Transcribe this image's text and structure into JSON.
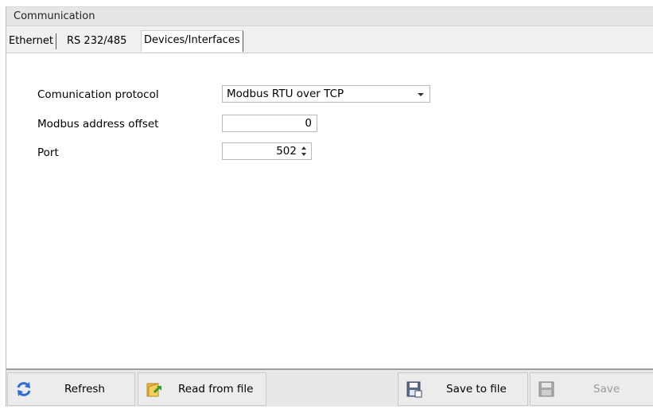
{
  "group": {
    "title": "Communication"
  },
  "tabs": [
    {
      "label": "Ethernet",
      "active": false
    },
    {
      "label": "RS 232/485",
      "active": false
    },
    {
      "label": "Devices/Interfaces",
      "active": true
    }
  ],
  "form": {
    "protocol_label": "Comunication protocol",
    "protocol_value": "Modbus RTU over TCP",
    "offset_label": "Modbus address offset",
    "offset_value": "0",
    "port_label": "Port",
    "port_value": "502"
  },
  "buttons": {
    "refresh": {
      "label": "Refresh",
      "icon": "refresh-icon"
    },
    "read": {
      "label": "Read from file",
      "icon": "folder-open-icon"
    },
    "save_file": {
      "label": "Save to file",
      "icon": "save-to-file-icon"
    },
    "save": {
      "label": "Save",
      "icon": "floppy-disk-icon",
      "enabled": false
    }
  },
  "colors": {
    "accent_blue": "#2f6fd0",
    "folder_yellow": "#e8b83a",
    "arrow_green": "#3a9a2a"
  }
}
